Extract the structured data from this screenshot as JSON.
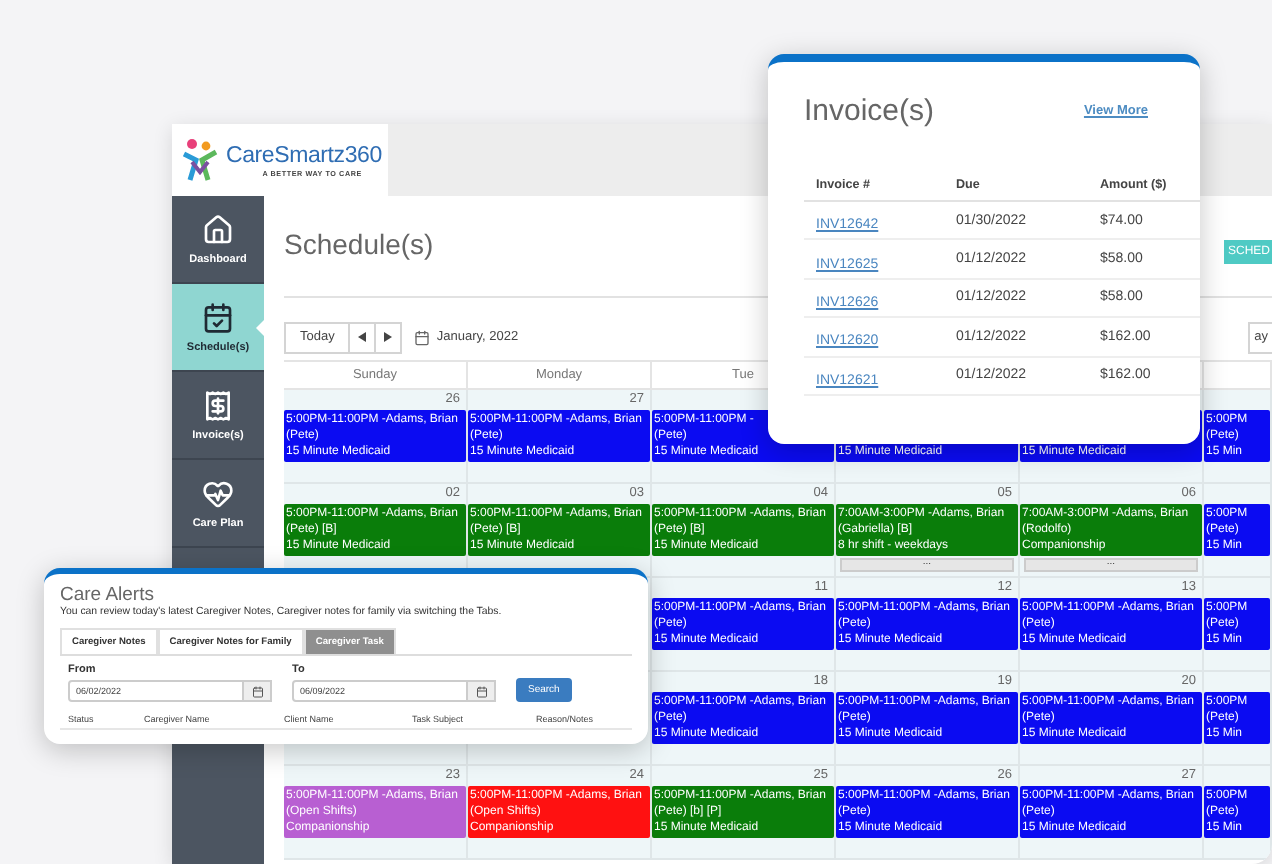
{
  "logo": {
    "name": "CareSmartz360",
    "tagline": "A BETTER WAY TO CARE"
  },
  "sidebar": {
    "items": [
      {
        "kind": "home",
        "label": "Dashboard",
        "selected": false
      },
      {
        "kind": "schedule",
        "label": "Schedule(s)",
        "selected": true
      },
      {
        "kind": "invoice",
        "label": "Invoice(s)",
        "selected": false
      },
      {
        "kind": "careplan",
        "label": "Care Plan",
        "selected": false
      }
    ]
  },
  "page_title": "Schedule(s)",
  "schedule_button": "SCHED",
  "toolbar": {
    "today": "Today",
    "month": "January, 2022",
    "view_button": "ay"
  },
  "calendar": {
    "days": [
      "Sunday",
      "Monday",
      "Tue"
    ],
    "weeks": [
      {
        "cells": [
          {
            "day": "26",
            "events": [
              {
                "color": "#0b0bf2",
                "lines": [
                  "5:00PM-11:00PM -Adams, Brian",
                  "(Pete)",
                  "15 Minute Medicaid"
                ]
              }
            ]
          },
          {
            "day": "27",
            "events": [
              {
                "color": "#0b0bf2",
                "lines": [
                  "5:00PM-11:00PM -Adams, Brian",
                  "(Pete)",
                  "15 Minute Medicaid"
                ]
              }
            ]
          },
          {
            "events": [
              {
                "color": "#0b0bf2",
                "lines": [
                  "5:00PM-11:00PM -",
                  "(Pete)",
                  "15 Minute Medicaid"
                ]
              }
            ]
          },
          {
            "events": [
              {
                "color": "#0b0bf2",
                "lines": [
                  "15 Minute Medicaid"
                ]
              }
            ]
          },
          {
            "events": [
              {
                "color": "#0b0bf2",
                "lines": [
                  "15 Minute Medicaid"
                ]
              }
            ]
          },
          {
            "events": [
              {
                "color": "#0b0bf2",
                "lines": [
                  "5:00PM",
                  "(Pete)",
                  "15 Min"
                ]
              }
            ]
          }
        ]
      },
      {
        "cells": [
          {
            "day": "02",
            "events": [
              {
                "color": "#0a7d0a",
                "lines": [
                  "5:00PM-11:00PM -Adams, Brian",
                  "(Pete) [B]",
                  "15 Minute Medicaid"
                ]
              }
            ]
          },
          {
            "day": "03",
            "events": [
              {
                "color": "#0a7d0a",
                "lines": [
                  "5:00PM-11:00PM -Adams, Brian",
                  "(Pete) [B]",
                  "15 Minute Medicaid"
                ]
              }
            ]
          },
          {
            "day": "04",
            "events": [
              {
                "color": "#0a7d0a",
                "lines": [
                  "5:00PM-11:00PM -Adams, Brian",
                  "(Pete) [B]",
                  "15 Minute Medicaid"
                ]
              }
            ]
          },
          {
            "day": "05",
            "events": [
              {
                "color": "#0a7d0a",
                "lines": [
                  "7:00AM-3:00PM -Adams, Brian",
                  "(Gabriella) [B]",
                  "8 hr shift - weekdays"
                ]
              }
            ],
            "more": "..."
          },
          {
            "day": "06",
            "events": [
              {
                "color": "#0a7d0a",
                "lines": [
                  "7:00AM-3:00PM -Adams, Brian",
                  "(Rodolfo)",
                  "Companionship"
                ]
              }
            ],
            "more": "..."
          },
          {
            "events": [
              {
                "color": "#0b0bf2",
                "lines": [
                  "5:00PM",
                  "(Pete)",
                  "15 Min"
                ]
              }
            ]
          }
        ]
      },
      {
        "cells": [
          {},
          {},
          {
            "day": "11",
            "events": [
              {
                "color": "#0b0bf2",
                "lines": [
                  "5:00PM-11:00PM -Adams, Brian",
                  "(Pete)",
                  "15 Minute Medicaid"
                ]
              }
            ]
          },
          {
            "day": "12",
            "events": [
              {
                "color": "#0b0bf2",
                "lines": [
                  "5:00PM-11:00PM -Adams, Brian",
                  "(Pete)",
                  "15 Minute Medicaid"
                ]
              }
            ]
          },
          {
            "day": "13",
            "events": [
              {
                "color": "#0b0bf2",
                "lines": [
                  "5:00PM-11:00PM -Adams, Brian",
                  "(Pete)",
                  "15 Minute Medicaid"
                ]
              }
            ]
          },
          {
            "events": [
              {
                "color": "#0b0bf2",
                "lines": [
                  "5:00PM",
                  "(Pete)",
                  "15 Min"
                ]
              }
            ]
          }
        ]
      },
      {
        "cells": [
          {},
          {},
          {
            "day": "18",
            "events": [
              {
                "color": "#0b0bf2",
                "lines": [
                  "5:00PM-11:00PM -Adams, Brian",
                  "(Pete)",
                  "15 Minute Medicaid"
                ]
              }
            ]
          },
          {
            "day": "19",
            "events": [
              {
                "color": "#0b0bf2",
                "lines": [
                  "5:00PM-11:00PM -Adams, Brian",
                  "(Pete)",
                  "15 Minute Medicaid"
                ]
              }
            ]
          },
          {
            "day": "20",
            "events": [
              {
                "color": "#0b0bf2",
                "lines": [
                  "5:00PM-11:00PM -Adams, Brian",
                  "(Pete)",
                  "15 Minute Medicaid"
                ]
              }
            ]
          },
          {
            "events": [
              {
                "color": "#0b0bf2",
                "lines": [
                  "5:00PM",
                  "(Pete)",
                  "15 Min"
                ]
              }
            ]
          }
        ]
      },
      {
        "cells": [
          {
            "day": "23",
            "events": [
              {
                "color": "#b85fd2",
                "lines": [
                  "5:00PM-11:00PM -Adams, Brian",
                  "(Open Shifts)",
                  "Companionship"
                ]
              }
            ]
          },
          {
            "day": "24",
            "events": [
              {
                "color": "#ff1111",
                "lines": [
                  "5:00PM-11:00PM -Adams, Brian",
                  "(Open Shifts)",
                  "Companionship"
                ]
              }
            ]
          },
          {
            "day": "25",
            "events": [
              {
                "color": "#0a7d0a",
                "lines": [
                  "5:00PM-11:00PM -Adams, Brian",
                  "(Pete) [b] [P]",
                  "15 Minute Medicaid"
                ]
              }
            ]
          },
          {
            "day": "26",
            "events": [
              {
                "color": "#0b0bf2",
                "lines": [
                  "5:00PM-11:00PM -Adams, Brian",
                  "(Pete)",
                  "15 Minute Medicaid"
                ]
              }
            ]
          },
          {
            "day": "27",
            "events": [
              {
                "color": "#0b0bf2",
                "lines": [
                  "5:00PM-11:00PM -Adams, Brian",
                  "(Pete)",
                  "15 Minute Medicaid"
                ]
              }
            ]
          },
          {
            "events": [
              {
                "color": "#0b0bf2",
                "lines": [
                  "5:00PM",
                  "(Pete)",
                  "15 Min"
                ]
              }
            ]
          }
        ]
      }
    ]
  },
  "invoice_card": {
    "title": "Invoice(s)",
    "link": "View More",
    "columns": [
      "Invoice #",
      "Due",
      "Amount ($)"
    ],
    "rows": [
      [
        "INV12642",
        "01/30/2022",
        "$74.00"
      ],
      [
        "INV12625",
        "01/12/2022",
        "$58.00"
      ],
      [
        "INV12626",
        "01/12/2022",
        "$58.00"
      ],
      [
        "INV12620",
        "01/12/2022",
        "$162.00"
      ],
      [
        "INV12621",
        "01/12/2022",
        "$162.00"
      ]
    ]
  },
  "care_alerts": {
    "title": "Care Alerts",
    "subtitle": "You can review today's latest Caregiver Notes, Caregiver notes for family via switching the Tabs.",
    "tabs": [
      {
        "label": "Caregiver Notes",
        "selected": false
      },
      {
        "label": "Caregiver Notes for Family",
        "selected": false
      },
      {
        "label": "Caregiver Task",
        "selected": true
      }
    ],
    "from": {
      "label": "From",
      "value": "06/02/2022"
    },
    "to": {
      "label": "To",
      "value": "06/09/2022"
    },
    "search": "Search",
    "columns": [
      "Status",
      "Caregiver Name",
      "Client Name",
      "Task Subject",
      "Reason/Notes"
    ]
  }
}
